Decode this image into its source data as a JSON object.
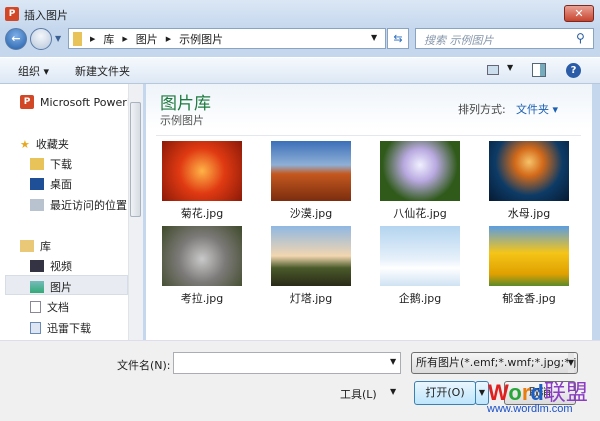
{
  "window": {
    "title": "插入图片",
    "close": "✕"
  },
  "address": {
    "crumbs": [
      "库",
      "图片",
      "示例图片"
    ],
    "search_placeholder": "搜索 示例图片"
  },
  "toolbar": {
    "organize": "组织 ▾",
    "new_folder": "新建文件夹"
  },
  "nav": {
    "items": [
      {
        "label": "Microsoft PowerPoint",
        "icon": "powerpoint-icon"
      },
      {
        "label": "收藏夹",
        "icon": "star-icon"
      },
      {
        "label": "下载",
        "icon": "download-folder-icon"
      },
      {
        "label": "桌面",
        "icon": "desktop-icon"
      },
      {
        "label": "最近访问的位置",
        "icon": "recent-places-icon"
      },
      {
        "label": "库",
        "icon": "library-icon"
      },
      {
        "label": "视频",
        "icon": "video-icon"
      },
      {
        "label": "图片",
        "icon": "pictures-icon"
      },
      {
        "label": "文档",
        "icon": "documents-icon"
      },
      {
        "label": "迅雷下载",
        "icon": "thunder-download-icon"
      }
    ],
    "selected": "图片"
  },
  "main": {
    "title": "图片库",
    "subtitle": "示例图片",
    "arrange_label": "排列方式:",
    "arrange_value": "文件夹 ▾",
    "files": [
      "菊花.jpg",
      "沙漠.jpg",
      "八仙花.jpg",
      "水母.jpg",
      "考拉.jpg",
      "灯塔.jpg",
      "企鹅.jpg",
      "郁金香.jpg"
    ]
  },
  "bottom": {
    "filename_label": "文件名(N):",
    "filename_value": "",
    "filter": "所有图片(*.emf;*.wmf;*.jpg;*.j",
    "tools": "工具(L)",
    "open": "打开(O)",
    "cancel": "取消"
  },
  "watermark": {
    "brand": "Word联盟",
    "url": "www.wordlm.com"
  }
}
